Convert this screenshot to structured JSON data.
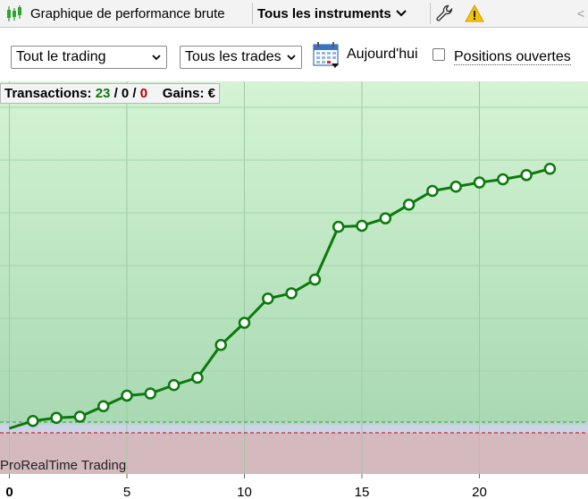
{
  "toolbar": {
    "title": "Graphique de performance brute",
    "instruments": "Tous les instruments",
    "icons": [
      "candlestick-icon",
      "chevron-down-icon",
      "wrench-icon",
      "warning-icon"
    ]
  },
  "filters": {
    "trading_select": "Tout le trading",
    "trades_select": "Tous les trades",
    "date_label": "Aujourd'hui",
    "open_positions_label": "Positions ouvertes",
    "open_positions_checked": false
  },
  "stats": {
    "transactions_label": "Transactions:",
    "wins": "23",
    "sep1": "/",
    "neutral": "0",
    "sep2": "/",
    "losses": "0",
    "gains_label": "Gains:",
    "gains_unit": "€"
  },
  "watermark": "ProRealTime Trading",
  "colors": {
    "line": "#0b7a0b",
    "profit_zone": "#c8ecc8",
    "loss_zone": "#d4b9bf",
    "win_marker": "#0b7a0b",
    "loss_marker": "#b00000"
  },
  "chart_data": {
    "type": "line",
    "xlabel": "",
    "ylabel": "",
    "x_ticks": [
      0,
      5,
      10,
      15,
      20
    ],
    "xlim": [
      0,
      24
    ],
    "ylim": [
      -0.3,
      3.3
    ],
    "grid": true,
    "series": [
      {
        "x": [
          0,
          1,
          2,
          3,
          4,
          5,
          6,
          7,
          8,
          9,
          10,
          11,
          12,
          13,
          14,
          15,
          16,
          17,
          18,
          19,
          20,
          21,
          22,
          23
        ],
        "values": [
          0,
          0.07,
          0.1,
          0.11,
          0.21,
          0.31,
          0.33,
          0.41,
          0.48,
          0.79,
          1.0,
          1.23,
          1.28,
          1.41,
          1.91,
          1.92,
          1.99,
          2.12,
          2.25,
          2.29,
          2.33,
          2.36,
          2.4,
          2.46
        ]
      }
    ]
  }
}
